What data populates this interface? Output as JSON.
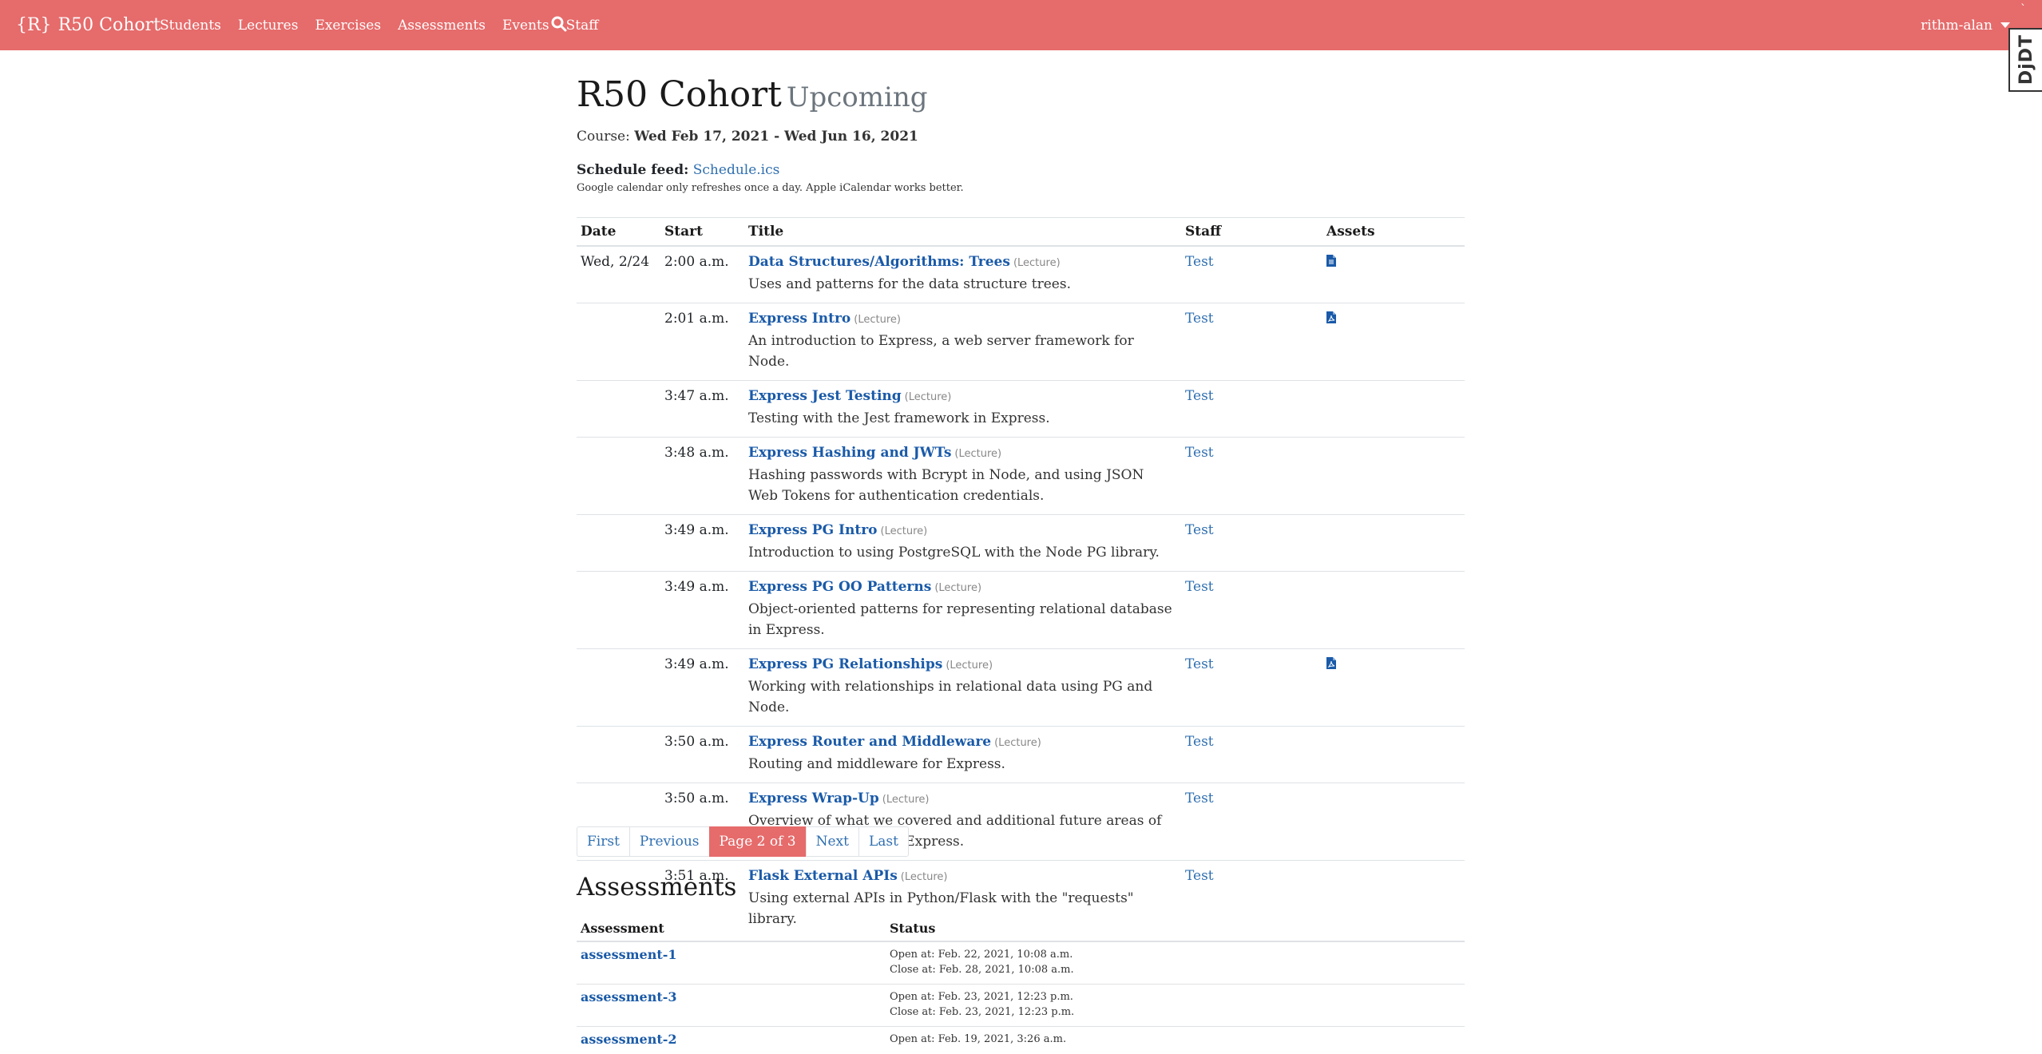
{
  "navbar": {
    "brand_logo": "{R}",
    "brand": "R50 Cohort",
    "links": [
      "Students",
      "Lectures",
      "Exercises",
      "Assessments",
      "Events",
      "Staff"
    ],
    "user": "rithm-alan",
    "debug_toolbar": "DjDT"
  },
  "page": {
    "title": "R50 Cohort",
    "subtitle": "Upcoming",
    "course_label": "Course:",
    "course_dates": "Wed Feb 17, 2021 - Wed Jun 16, 2021",
    "feed_label": "Schedule feed:",
    "feed_link": "Schedule.ics",
    "feed_note": "Google calendar only refreshes once a day. Apple iCalendar works better."
  },
  "schedule": {
    "headers": [
      "Date",
      "Start",
      "Title",
      "Staff",
      "Assets"
    ],
    "rows": [
      {
        "date": "Wed, 2/24",
        "start": "2:00 a.m.",
        "title": "Data Structures/Algorithms: Trees",
        "type": "(Lecture)",
        "desc": "Uses and patterns for the data structure trees.",
        "staff": "Test",
        "asset": "file-icon"
      },
      {
        "date": "",
        "start": "2:01 a.m.",
        "title": "Express Intro",
        "type": "(Lecture)",
        "desc": "An introduction to Express, a web server framework for Node.",
        "staff": "Test",
        "asset": "pdf-icon"
      },
      {
        "date": "",
        "start": "3:47 a.m.",
        "title": "Express Jest Testing",
        "type": "(Lecture)",
        "desc": "Testing with the Jest framework in Express.",
        "staff": "Test",
        "asset": ""
      },
      {
        "date": "",
        "start": "3:48 a.m.",
        "title": "Express Hashing and JWTs",
        "type": "(Lecture)",
        "desc": "Hashing passwords with Bcrypt in Node, and using JSON Web Tokens for authentication credentials.",
        "staff": "Test",
        "asset": ""
      },
      {
        "date": "",
        "start": "3:49 a.m.",
        "title": "Express PG Intro",
        "type": "(Lecture)",
        "desc": "Introduction to using PostgreSQL with the Node PG library.",
        "staff": "Test",
        "asset": ""
      },
      {
        "date": "",
        "start": "3:49 a.m.",
        "title": "Express PG OO Patterns",
        "type": "(Lecture)",
        "desc": "Object-oriented patterns for representing relational database in Express.",
        "staff": "Test",
        "asset": ""
      },
      {
        "date": "",
        "start": "3:49 a.m.",
        "title": "Express PG Relationships",
        "type": "(Lecture)",
        "desc": "Working with relationships in relational data using PG and Node.",
        "staff": "Test",
        "asset": "pdf-icon"
      },
      {
        "date": "",
        "start": "3:50 a.m.",
        "title": "Express Router and Middleware",
        "type": "(Lecture)",
        "desc": "Routing and middleware for Express.",
        "staff": "Test",
        "asset": ""
      },
      {
        "date": "",
        "start": "3:50 a.m.",
        "title": "Express Wrap-Up",
        "type": "(Lecture)",
        "desc": "Overview of what we covered and additional future areas of learning for Node and Express.",
        "staff": "Test",
        "asset": ""
      },
      {
        "date": "",
        "start": "3:51 a.m.",
        "title": "Flask External APIs",
        "type": "(Lecture)",
        "desc": "Using external APIs in Python/Flask with the \"requests\" library.",
        "staff": "Test",
        "asset": ""
      }
    ]
  },
  "pagination": {
    "first": "First",
    "previous": "Previous",
    "current": "Page 2 of 3",
    "next": "Next",
    "last": "Last"
  },
  "assessments": {
    "heading": "Assessments",
    "headers": [
      "Assessment",
      "Status"
    ],
    "rows": [
      {
        "name": "assessment-1",
        "open": "Open at: Feb. 22, 2021, 10:08 a.m.",
        "close": "Close at: Feb. 28, 2021, 10:08 a.m."
      },
      {
        "name": "assessment-3",
        "open": "Open at: Feb. 23, 2021, 12:23 p.m.",
        "close": "Close at: Feb. 23, 2021, 12:23 p.m."
      },
      {
        "name": "assessment-2",
        "open": "Open at: Feb. 19, 2021, 3:26 a.m.",
        "close": ""
      }
    ]
  },
  "colors": {
    "navbar": "#e66b6b",
    "link": "#2f6fb0",
    "title_link": "#1a5aa8"
  }
}
